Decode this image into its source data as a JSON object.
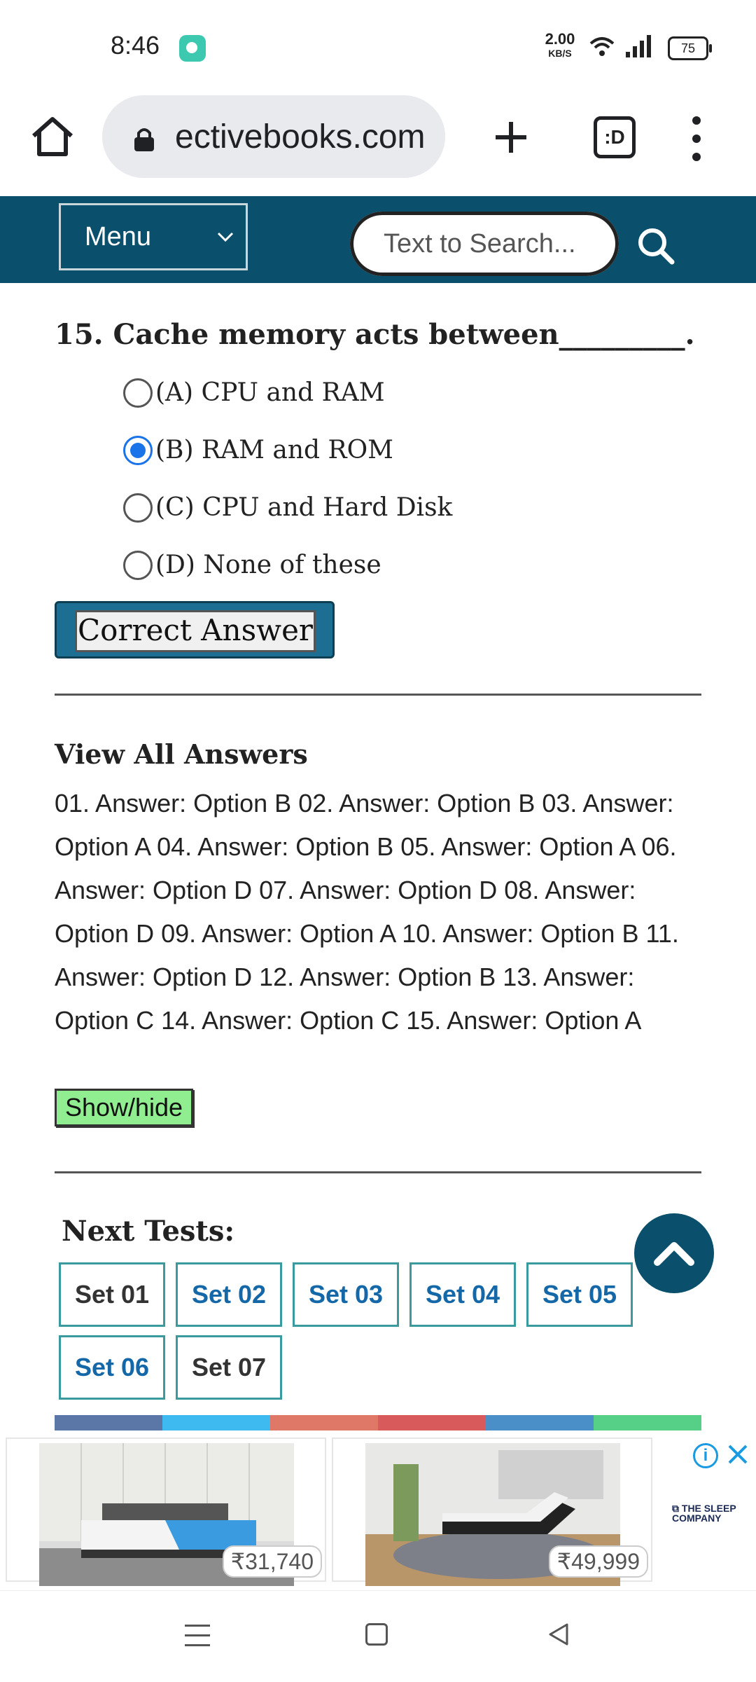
{
  "status_bar": {
    "time": "8:46",
    "net_speed_value": "2.00",
    "net_speed_unit": "KB/S",
    "battery": "75"
  },
  "browser": {
    "url": "ectivebooks.com",
    "tabs_label": ":D"
  },
  "site_header": {
    "menu_label": "Menu",
    "search_placeholder": "Text to Search..."
  },
  "question": {
    "text": "15. Cache memory acts between_________.",
    "options": [
      {
        "label": "(A) CPU and RAM",
        "selected": false
      },
      {
        "label": "(B) RAM and ROM",
        "selected": true
      },
      {
        "label": "(C) CPU and Hard Disk",
        "selected": false
      },
      {
        "label": "(D) None of these",
        "selected": false
      }
    ],
    "answer_button": "Correct Answer"
  },
  "answers": {
    "title": "View All Answers",
    "body": "01. Answer: Option B 02. Answer: Option B 03. Answer: Option A 04. Answer: Option B 05. Answer: Option A 06. Answer: Option D 07. Answer: Option D 08. Answer: Option D 09. Answer: Option A 10. Answer: Option B 11. Answer: Option D 12. Answer: Option B 13. Answer: Option C 14. Answer: Option C 15. Answer: Option A",
    "toggle": "Show/hide"
  },
  "next_tests": {
    "title": "Next Tests:",
    "sets": [
      {
        "label": "Set 01",
        "style": "plain"
      },
      {
        "label": "Set 02",
        "style": "link"
      },
      {
        "label": "Set 03",
        "style": "link"
      },
      {
        "label": "Set 04",
        "style": "link"
      },
      {
        "label": "Set 05",
        "style": "link"
      },
      {
        "label": "Set 06",
        "style": "link"
      },
      {
        "label": "Set 07",
        "style": "plain"
      }
    ]
  },
  "share_colors": [
    "#5b77a8",
    "#3ebaf0",
    "#e07868",
    "#d85a5a",
    "#4a8fc8",
    "#55d086"
  ],
  "ad": {
    "products": [
      {
        "price": "₹31,740"
      },
      {
        "price": "₹49,999"
      }
    ],
    "brand": "THE SLEEP COMPANY"
  },
  "colors": {
    "header_bg": "#0a4f6b",
    "radio_selected": "#1a73e8",
    "showhide_bg": "#90ee90",
    "set_link": "#1568a8"
  }
}
